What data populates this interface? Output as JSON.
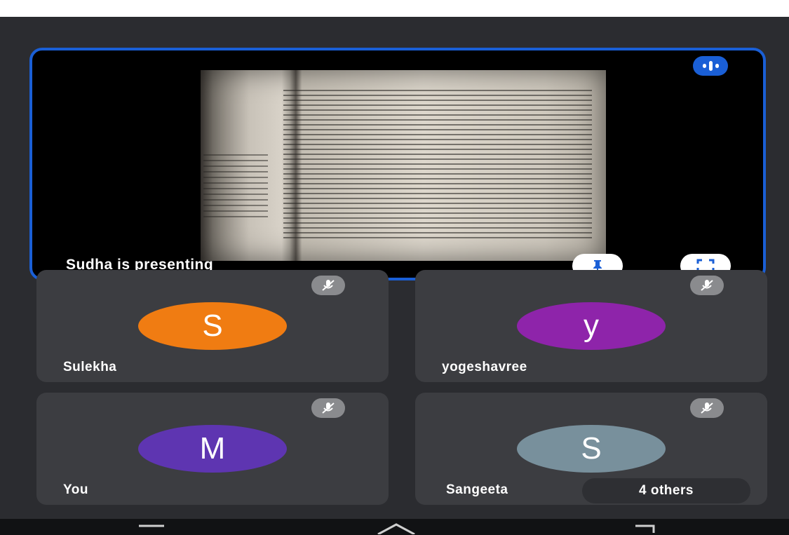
{
  "presenter": {
    "label": "Sudha is presenting",
    "icons": {
      "audio": "audio-level-icon",
      "pin": "pin-icon",
      "fullscreen": "fullscreen-icon"
    }
  },
  "participants": [
    {
      "initial": "S",
      "name": "Sulekha",
      "avatar_color": "#f07c12",
      "muted": true
    },
    {
      "initial": "y",
      "name": "yogeshavree",
      "avatar_color": "#8e24aa",
      "muted": true
    },
    {
      "initial": "M",
      "name": "You",
      "avatar_color": "#5e35b1",
      "muted": true
    },
    {
      "initial": "S",
      "name": "Sangeeta",
      "avatar_color": "#78909c",
      "muted": true
    }
  ],
  "others": {
    "label": "4 others"
  },
  "colors": {
    "accent": "#1a5fd6",
    "background": "#2b2c30",
    "tile": "#3c3d41"
  },
  "navbar": {
    "icons": [
      "menu-icon",
      "home-icon",
      "back-icon"
    ]
  }
}
